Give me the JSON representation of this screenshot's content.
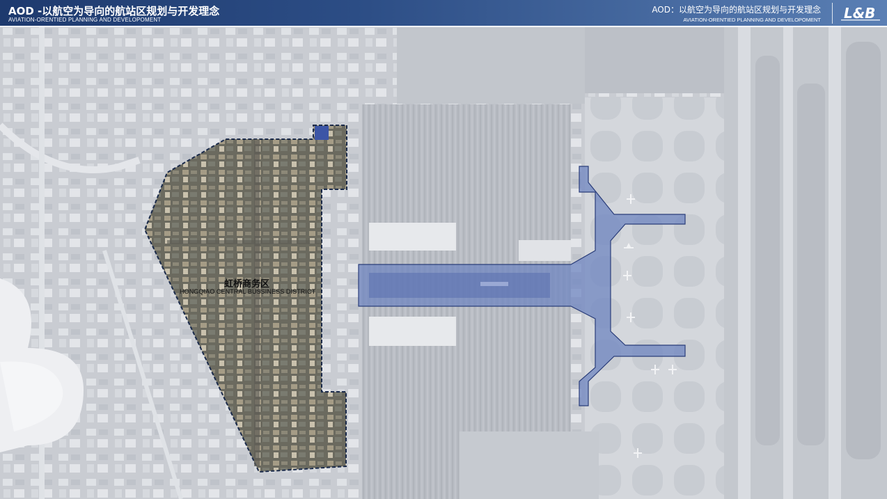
{
  "header": {
    "title": "AOD -以航空为导向的航站区规划与开发理念",
    "subtitle": "AVIATION-ORENTIED PLANNING AND DEVELOPOMENT",
    "right_title": "AOD：以航空为导向的航站区规划与开发理念",
    "right_subtitle": "AVIATION-ORENTIED PLANNING AND DEVELOPOMENT",
    "logo_text": "L&B"
  },
  "map": {
    "district_label_cn": "虹桥商务区",
    "district_label_en": "HONGQIAO CENTRAL BUSSINESS DISTRICT"
  },
  "colors": {
    "header_dark": "#1e3a6e",
    "header_light": "#5a7fb4",
    "terminal_fill": "#6f85c0",
    "boundary": "#1a2a4a"
  }
}
